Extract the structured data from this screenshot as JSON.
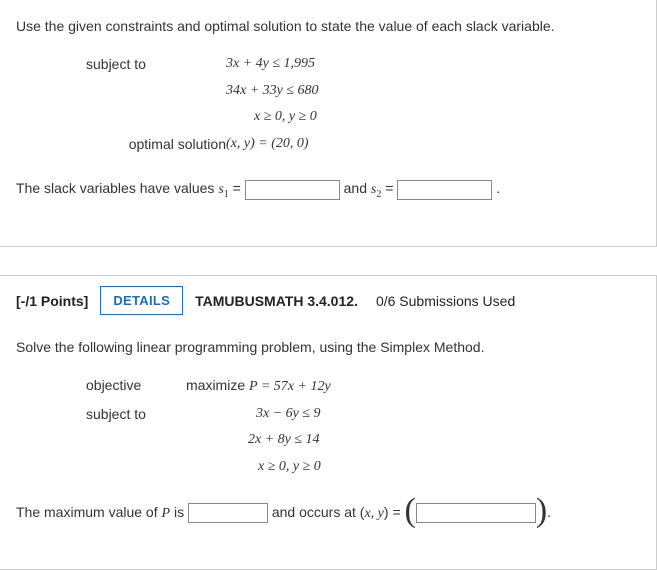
{
  "q1": {
    "prompt": "Use the given constraints and optimal solution to state the value of each slack variable.",
    "subject_to_label": "subject to",
    "constraints": [
      "3x + 4y ≤ 1,995",
      "34x + 33y ≤ 680",
      "x ≥ 0, y ≥ 0"
    ],
    "optimal_label": "optimal solution",
    "optimal_value": "(x, y) = (20, 0)",
    "answer_prefix": "The slack variables have values ",
    "s1_label": "s",
    "s1_sub": "1",
    "eq": " = ",
    "and_text": " and ",
    "s2_label": "s",
    "s2_sub": "2",
    "period": " ."
  },
  "q2": {
    "points": "[-/1 Points]",
    "details_label": "DETAILS",
    "source": "TAMUBUSMATH 3.4.012.",
    "subs_used": "0/6 Submissions Used",
    "prompt": "Solve the following linear programming problem, using the Simplex Method.",
    "objective_label": "objective",
    "objective_expr": "maximize P = 57x + 12y",
    "subject_to_label": "subject to",
    "constraints": [
      "3x − 6y ≤ 9",
      "2x + 8y ≤ 14",
      "x ≥ 0, y ≥ 0"
    ],
    "answer_prefix": "The maximum value of ",
    "p_var": "P",
    "is_text": " is ",
    "occurs_text": " and occurs at (",
    "xy_text": "x, y",
    "paren_eq": ") = ",
    "big_open": "(",
    "big_close": ")",
    "period": "."
  }
}
